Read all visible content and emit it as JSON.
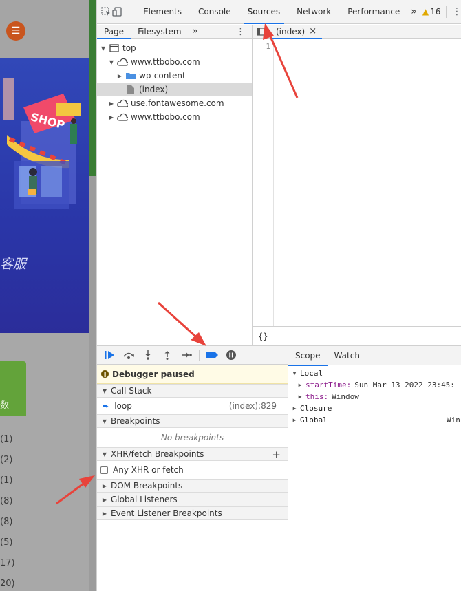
{
  "webpage": {
    "menu_icon": "menu-icon",
    "hero_text": "客服",
    "green_text": "数",
    "counts": [
      "(1)",
      "(2)",
      "(1)",
      "(8)",
      "(8)",
      "(5)",
      "17)",
      "20)"
    ],
    "shop_sign": "SHOP"
  },
  "devtools": {
    "tabs": [
      "Elements",
      "Console",
      "Sources",
      "Network",
      "Performance"
    ],
    "active_tab": "Sources",
    "more_tabs": "»",
    "warnings_count": "16",
    "navigator": {
      "tabs": [
        "Page",
        "Filesystem"
      ],
      "more": "»",
      "tree": [
        {
          "label": "top",
          "icon": "frame-icon",
          "depth": 0,
          "expanded": true
        },
        {
          "label": "www.ttbobo.com",
          "icon": "cloud-icon",
          "depth": 1,
          "expanded": true
        },
        {
          "label": "wp-content",
          "icon": "folder-icon",
          "depth": 2,
          "expanded": false
        },
        {
          "label": "(index)",
          "icon": "file-icon",
          "depth": 2,
          "selected": true
        },
        {
          "label": "use.fontawesome.com",
          "icon": "cloud-icon",
          "depth": 1,
          "expanded": false
        },
        {
          "label": "www.ttbobo.com",
          "icon": "cloud-icon",
          "depth": 1,
          "expanded": false
        }
      ]
    },
    "editor": {
      "file_tab": "(index)",
      "close": "×",
      "line_number": "1",
      "pretty_print": "{}"
    },
    "debugger": {
      "paused_message": "Debugger paused",
      "call_stack_title": "Call Stack",
      "call_stack": [
        {
          "name": "loop",
          "location": "(index):829"
        }
      ],
      "breakpoints_title": "Breakpoints",
      "no_breakpoints": "No breakpoints",
      "xhr_title": "XHR/fetch Breakpoints",
      "xhr_item": "Any XHR or fetch",
      "dom_title": "DOM Breakpoints",
      "global_listeners_title": "Global Listeners",
      "event_listener_title": "Event Listener Breakpoints"
    },
    "scope": {
      "tabs": [
        "Scope",
        "Watch"
      ],
      "local_label": "Local",
      "start_time_key": "startTime:",
      "start_time_val": "Sun Mar 13 2022 23:45:",
      "this_key": "this:",
      "this_val": "Window",
      "closure_label": "Closure",
      "global_label": "Global",
      "global_val": "Win"
    }
  },
  "colors": {
    "accent": "#1a73e8",
    "arrow": "#e8433b",
    "paused_bg": "#fffbe6"
  }
}
